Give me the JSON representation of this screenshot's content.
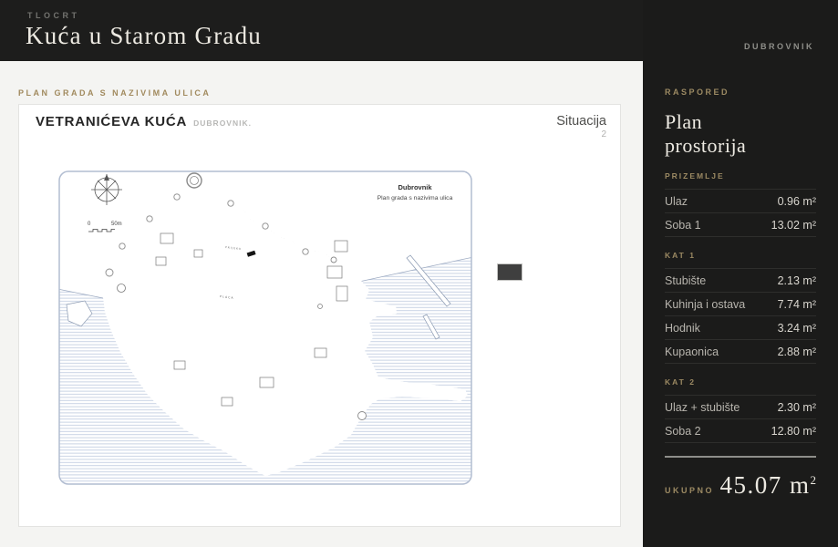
{
  "header": {
    "eyebrow": "TLOCRT",
    "title": "Kuća u Starom Gradu",
    "location": "DUBROVNIK"
  },
  "content": {
    "section_label": "PLAN GRADA S NAZIVIMA ULICA",
    "card": {
      "title": "VETRANIĆEVA KUĆA",
      "subtitle": "DUBROVNIK.",
      "corner_label": "Situacija",
      "corner_number": "2",
      "map": {
        "title": "Dubrovnik",
        "subtitle": "Plan grada s nazivima ulica",
        "scale_start": "0",
        "scale_end": "50m",
        "street_labels": [
          "PLACA",
          "PRIJEKO"
        ]
      }
    }
  },
  "sidebar": {
    "eyebrow": "RASPORED",
    "title": "Plan prostorija",
    "sections": [
      {
        "label": "PRIZEMLJE",
        "rooms": [
          {
            "name": "Ulaz",
            "area": "0.96 m²"
          },
          {
            "name": "Soba 1",
            "area": "13.02 m²"
          }
        ]
      },
      {
        "label": "KAT 1",
        "rooms": [
          {
            "name": "Stubište",
            "area": "2.13 m²"
          },
          {
            "name": "Kuhinja i ostava",
            "area": "7.74 m²"
          },
          {
            "name": "Hodnik",
            "area": "3.24 m²"
          },
          {
            "name": "Kupaonica",
            "area": "2.88 m²"
          }
        ]
      },
      {
        "label": "KAT 2",
        "rooms": [
          {
            "name": "Ulaz + stubište",
            "area": "2.30 m²"
          },
          {
            "name": "Soba 2",
            "area": "12.80 m²"
          }
        ]
      }
    ],
    "total_label": "UKUPNO",
    "total_value": "45.07 m",
    "total_sup": "2"
  },
  "colors": {
    "accent_gold": "#9c8a63",
    "dark_bg": "#1c1c1b",
    "page_bg": "#f4f4f2",
    "sea_line": "#c2cde0",
    "map_frame": "#b2bdd1",
    "marker_black": "#141414"
  }
}
